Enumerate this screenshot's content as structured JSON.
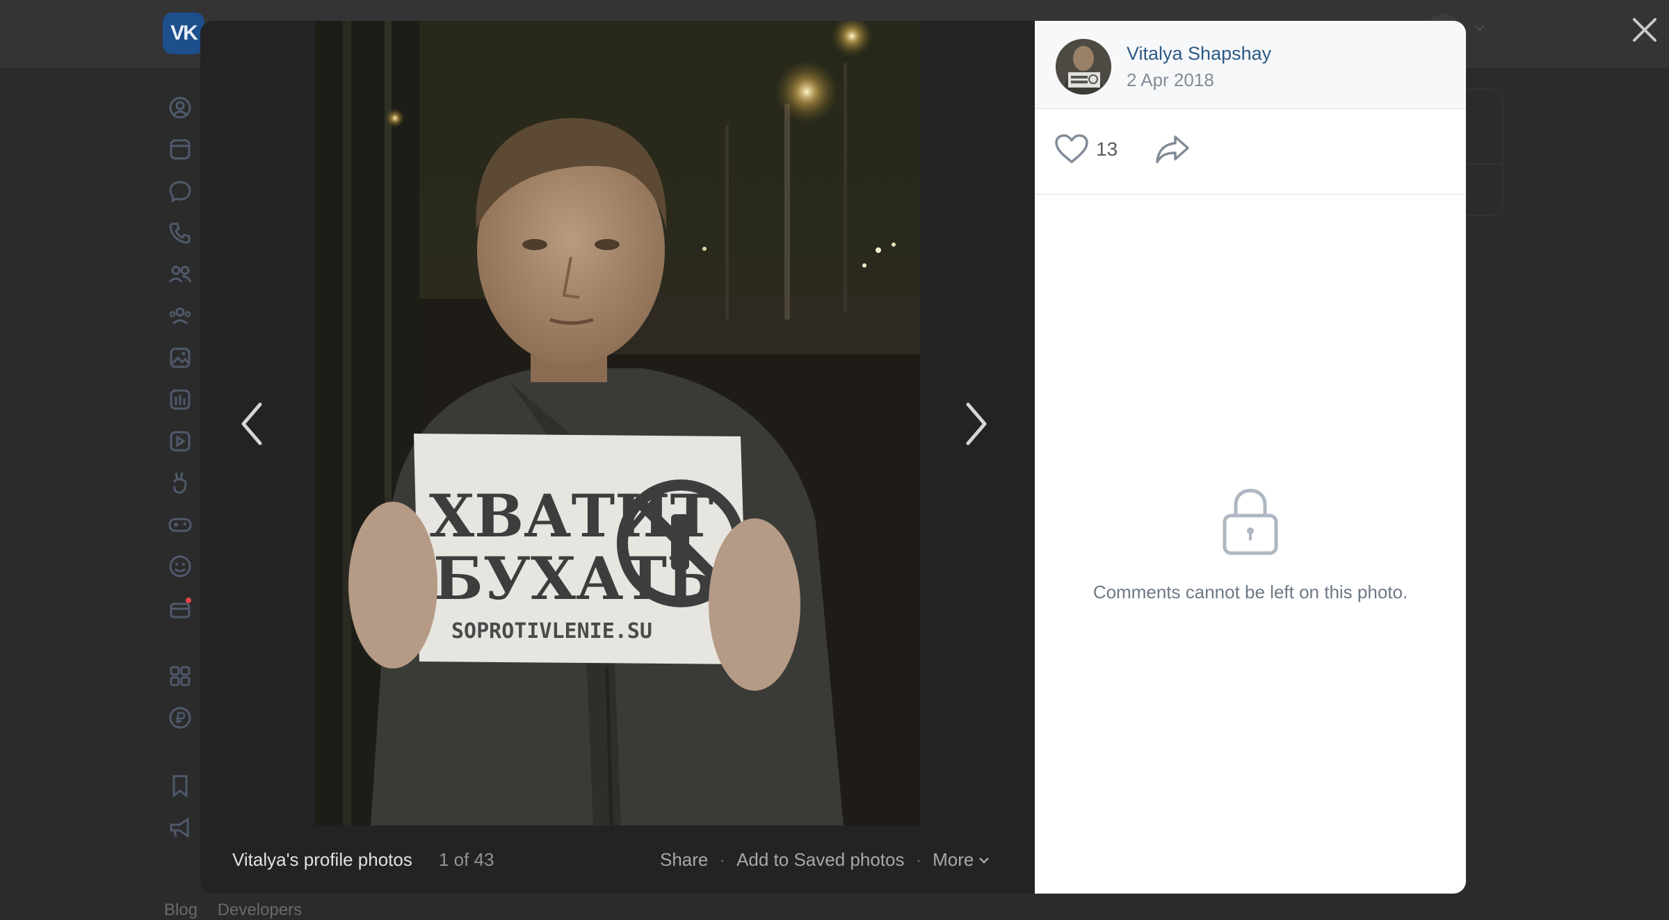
{
  "background": {
    "logo_text": "VK",
    "footer_links": [
      "Blog",
      "Developers"
    ],
    "sidebar_icons": [
      "profile-icon",
      "news-icon",
      "messenger-icon",
      "calls-icon",
      "friends-icon",
      "communities-icon",
      "photos-icon",
      "music-icon",
      "video-icon",
      "clips-icon",
      "games-icon",
      "stickers-icon",
      "gifts-icon",
      "apps-icon",
      "vk-pay-icon",
      "bookmarks-icon",
      "ads-icon"
    ]
  },
  "viewer": {
    "album_title": "Vitalya's profile photos",
    "counter": "1 of 43",
    "actions": {
      "share": "Share",
      "save": "Add to Saved photos",
      "more": "More",
      "separator": "·"
    },
    "photo": {
      "sign_line1": "ХВАТИТ",
      "sign_line2": "БУХАТЬ",
      "sign_url": "SOPROTIVLENIE.SU"
    }
  },
  "panel": {
    "author_name": "Vitalya Shapshay",
    "date": "2 Apr 2018",
    "likes": "13",
    "comments_locked_text": "Comments cannot be left on this photo."
  },
  "colors": {
    "accent_name": "#2c5985",
    "muted": "#818c99",
    "overlay": "#2b2b2c",
    "modal_dark": "#232324"
  }
}
